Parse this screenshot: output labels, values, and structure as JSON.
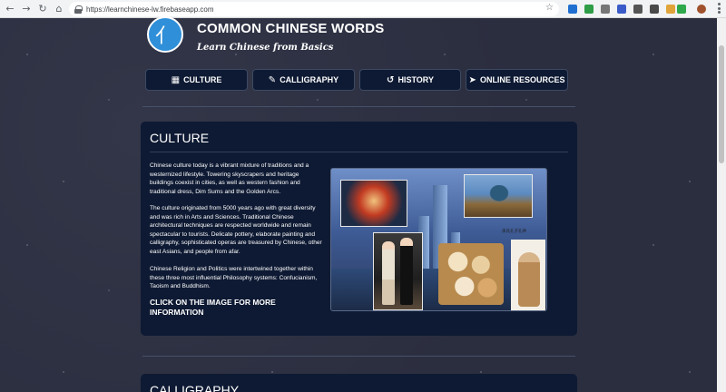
{
  "browser": {
    "url": "https://learnchinese-lw.firebaseapp.com"
  },
  "header": {
    "title": "COMMON CHINESE WORDS",
    "subtitle": "Learn Chinese from Basics",
    "logo_glyph": "亻"
  },
  "nav": [
    {
      "label": "CULTURE",
      "icon": "building-columns-icon",
      "glyph": "▦"
    },
    {
      "label": "CALLIGRAPHY",
      "icon": "edit-icon",
      "glyph": "✎"
    },
    {
      "label": "HISTORY",
      "icon": "history-icon",
      "glyph": "↺"
    },
    {
      "label": "ONLINE RESOURCES",
      "icon": "pointer-icon",
      "glyph": "➤"
    }
  ],
  "culture": {
    "title": "CULTURE",
    "paragraphs": [
      "Chinese culture today is a vibrant mixture of traditions and a westernized lifestyle. Towering skyscrapers and heritage buildings coexist in cities, as well as western fashion and traditional dress, Dim Sums and the Golden Arcs.",
      "The culture originated from 5000 years ago with great diversity and was rich in Arts and Sciences. Traditional Chinese architectural techniques are respected worldwide and remain spectacular to tourists. Delicate pottery, elaborate painting and calligraphy, sophisticated operas are treasured by Chinese, other east Asians, and people from afar.",
      "Chinese Religion and Politics were intertwined together within these three most influential Philosophy systems: Confucianism, Taoism and Buddhism."
    ],
    "cta": "CLICK ON THE IMAGE FOR MORE INFORMATION",
    "image_text": "孫氏孔子孔神"
  },
  "calligraphy": {
    "title": "CALLIGRAPHY"
  }
}
